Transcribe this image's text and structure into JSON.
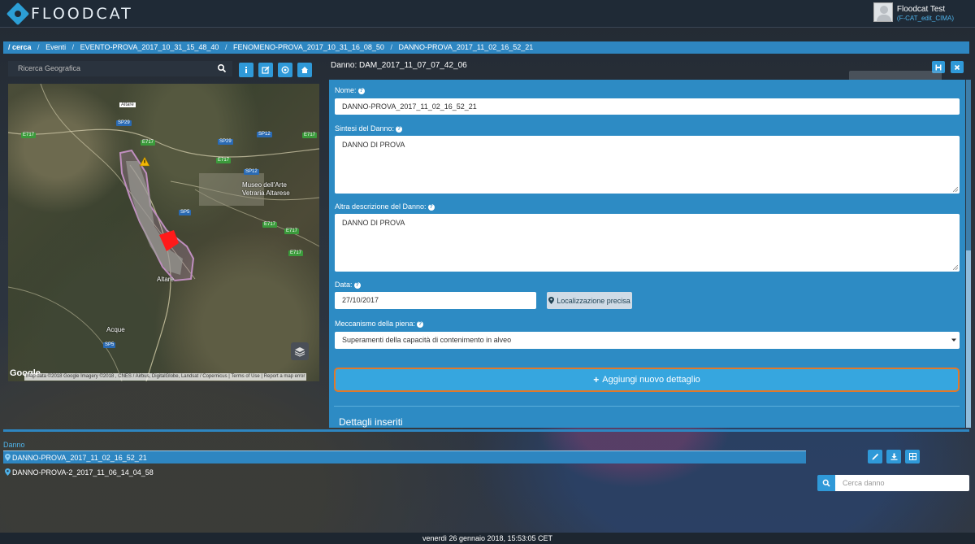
{
  "app": {
    "logo_text": "FLOODCAT"
  },
  "user": {
    "name": "Floodcat Test",
    "role": "(F-CAT_edit_CIMA)"
  },
  "breadcrumb": {
    "items": [
      "/ cerca",
      "Eventi",
      "EVENTO-PROVA_2017_10_31_15_48_40",
      "FENOMENO-PROVA_2017_10_31_16_08_50",
      "DANNO-PROVA_2017_11_02_16_52_21"
    ],
    "separator": "/"
  },
  "geo_search": {
    "placeholder": "Ricerca Geografica"
  },
  "toolbar": {
    "icons": [
      "info-icon",
      "edit-icon",
      "target-icon",
      "home-icon"
    ]
  },
  "map": {
    "labels": {
      "altare_top": "Altare",
      "museo_line1": "Museo dell'Arte",
      "museo_line2": "Vetraria Altarese",
      "altare": "Altare",
      "acque": "Acque"
    },
    "road_tags": {
      "sp29a": "SP29",
      "sp29b": "SP29",
      "sp12a": "SP12",
      "sp12b": "SP12",
      "sp5a": "SP5",
      "sp5b": "SP5",
      "e717a": "E717",
      "e717b": "E717",
      "e717c": "E717",
      "e717d": "E717",
      "e717e": "E717",
      "e717f": "E717",
      "e717g": "E717"
    },
    "google": "Google",
    "attribution": "Map data ©2018 Google Imagery ©2018 , CNES / Airbus, DigitalGlobe, Landsat / Copernicus | Terms of Use | Report a map error"
  },
  "danno": {
    "title": "Danno: DAM_2017_11_07_07_42_06",
    "form": {
      "nome_label": "Nome:",
      "nome_value": "DANNO-PROVA_2017_11_02_16_52_21",
      "sintesi_label": "Sintesi del Danno:",
      "sintesi_value": "DANNO DI PROVA",
      "altra_label": "Altra descrizione del Danno:",
      "altra_value": "DANNO DI PROVA",
      "data_label": "Data:",
      "data_value": "27/10/2017",
      "localizzazione_button": "Localizzazione precisa",
      "meccanismo_label": "Meccanismo della piena:",
      "meccanismo_value": "Superamenti della capacità di contenimento in alveo",
      "add_detail_button": "Aggiungi nuovo dettaglio",
      "details_heading": "Dettagli inseriti"
    }
  },
  "list": {
    "header": "Danno",
    "rows": [
      {
        "label": "DANNO-PROVA_2017_11_02_16_52_21",
        "selected": true
      },
      {
        "label": "DANNO-PROVA-2_2017_11_06_14_04_58",
        "selected": false
      }
    ],
    "search_placeholder": "Cerca danno"
  },
  "status": {
    "datetime": "venerdì 26 gennaio 2018, 15:53:05 CET"
  },
  "colors": {
    "accent": "#2e86c1",
    "button": "#2f99d8",
    "highlight_border": "#e2792a",
    "user_role": "#4fb3ea"
  }
}
